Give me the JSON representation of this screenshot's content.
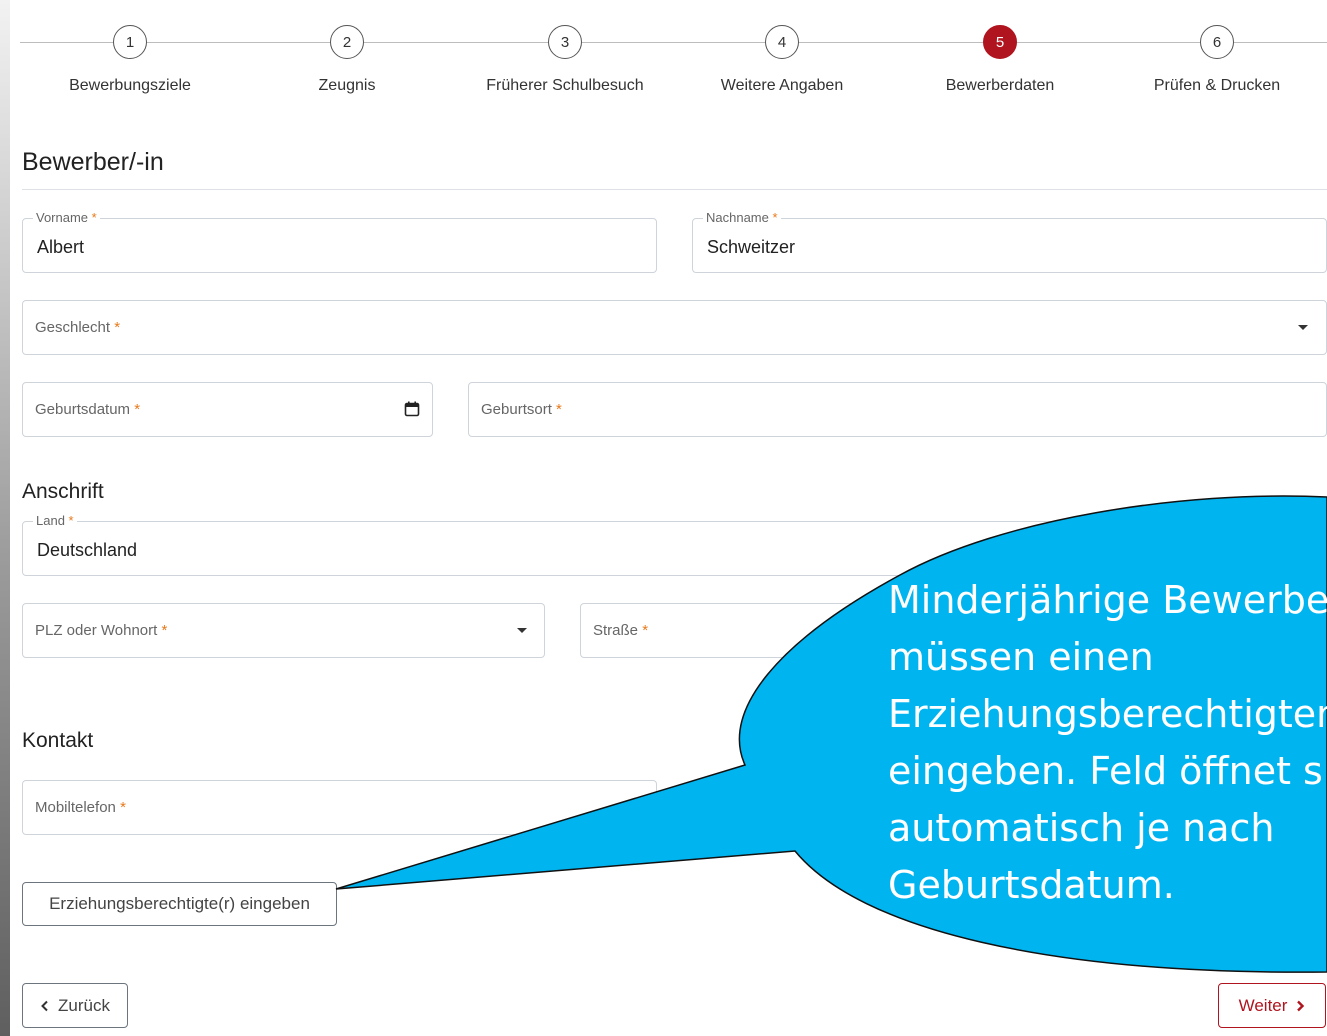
{
  "stepper": {
    "steps": [
      {
        "number": "1",
        "label": "Bewerbungsziele",
        "active": false
      },
      {
        "number": "2",
        "label": "Zeugnis",
        "active": false
      },
      {
        "number": "3",
        "label": "Früherer Schulbesuch",
        "active": false
      },
      {
        "number": "4",
        "label": "Weitere Angaben",
        "active": false
      },
      {
        "number": "5",
        "label": "Bewerberdaten",
        "active": true
      },
      {
        "number": "6",
        "label": "Prüfen & Drucken",
        "active": false
      }
    ]
  },
  "applicant": {
    "title": "Bewerber/-in",
    "firstname": {
      "label": "Vorname",
      "value": "Albert"
    },
    "lastname": {
      "label": "Nachname",
      "value": "Schweitzer"
    },
    "gender": {
      "placeholder": "Geschlecht"
    },
    "birthdate": {
      "placeholder": "Geburtsdatum"
    },
    "birthplace": {
      "placeholder": "Geburtsort"
    }
  },
  "address": {
    "title": "Anschrift",
    "country": {
      "label": "Land",
      "value": "Deutschland"
    },
    "zip": {
      "placeholder": "PLZ oder Wohnort"
    },
    "street": {
      "placeholder": "Straße"
    }
  },
  "contact": {
    "title": "Kontakt",
    "mobile": {
      "placeholder": "Mobiltelefon"
    }
  },
  "required_mark": "*",
  "buttons": {
    "guardian": "Erziehungsberechtigte(r) eingeben",
    "back": "Zurück",
    "next": "Weiter"
  },
  "callout": {
    "lines": [
      "Minderjährige Bewerbe",
      "müssen einen",
      "Erziehungsberechtigten",
      "eingeben. Feld öffnet s",
      "automatisch je nach",
      "Geburtsdatum."
    ],
    "fill": "#00b4f0",
    "text_color": "#ffffff"
  },
  "colors": {
    "accent": "#b0141e",
    "required": "#e8791a"
  },
  "icons": {
    "calendar": "calendar-icon",
    "dropdown": "chevron-down-icon",
    "back": "chevron-left-icon",
    "next": "chevron-right-icon"
  }
}
